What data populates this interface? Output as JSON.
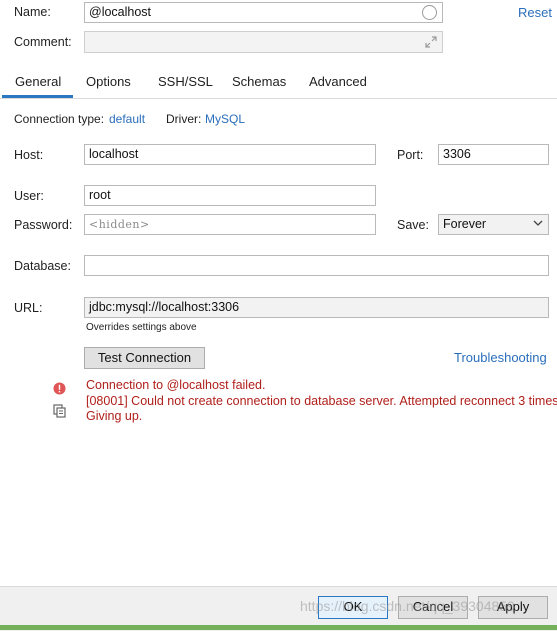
{
  "header": {
    "name_label": "Name:",
    "name_value": "@localhost",
    "reset_label": "Reset",
    "comment_label": "Comment:",
    "comment_value": ""
  },
  "tabs": [
    {
      "label": "General",
      "active": true
    },
    {
      "label": "Options",
      "active": false
    },
    {
      "label": "SSH/SSL",
      "active": false
    },
    {
      "label": "Schemas",
      "active": false
    },
    {
      "label": "Advanced",
      "active": false
    }
  ],
  "connection": {
    "type_label": "Connection type:",
    "type_value": "default",
    "driver_label": "Driver:",
    "driver_value": "MySQL"
  },
  "form": {
    "host_label": "Host:",
    "host_value": "localhost",
    "port_label": "Port:",
    "port_value": "3306",
    "user_label": "User:",
    "user_value": "root",
    "password_label": "Password:",
    "password_placeholder": "<hidden>",
    "save_label": "Save:",
    "save_value": "Forever",
    "database_label": "Database:",
    "database_value": "",
    "url_label": "URL:",
    "url_value": "jdbc:mysql://localhost:3306",
    "url_hint": "Overrides settings above"
  },
  "actions": {
    "test_connection": "Test Connection",
    "troubleshooting": "Troubleshooting"
  },
  "error": {
    "line1": "Connection to @localhost failed.",
    "line2": "[08001] Could not create connection to database server. Attempted reconnect 3 times.",
    "line3": "Giving up.",
    "color": "#b0201b"
  },
  "footer": {
    "ok": "OK",
    "cancel": "Cancel",
    "apply": "Apply",
    "watermark": "https://blog.csdn.net/qq_39304859"
  },
  "colors": {
    "accent": "#2b78c2",
    "link": "#2a6ebb",
    "error_icon": "#e05555"
  }
}
